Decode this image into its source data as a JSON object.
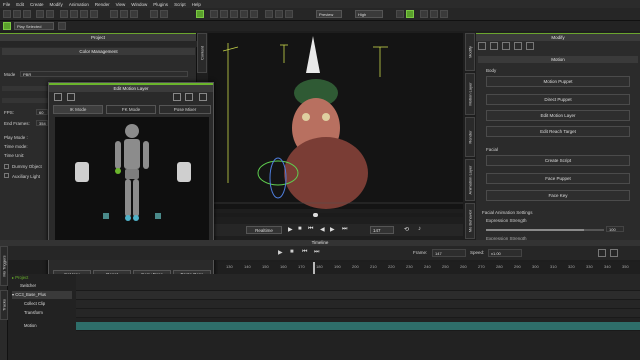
{
  "menu": [
    "File",
    "Edit",
    "Create",
    "Modify",
    "Animation",
    "Render",
    "View",
    "Window",
    "Plugins",
    "Script",
    "Help"
  ],
  "toolbar": {
    "render_quality": "Preview",
    "render_level": "High",
    "play_selected": "Play Selected"
  },
  "project_panel": {
    "title": "Project",
    "section": "Color Management",
    "mode_label": "Mode",
    "mode_value": "PBR",
    "fps_label": "FPS:",
    "fps_value": "60",
    "end_frame_label": "End Frames:",
    "end_frame_value": "354",
    "play_mode_label": "Play Mode :",
    "time_mode_label": "Time mode:",
    "time_unit_label": "Time Unit:",
    "dummy_object_label": "Dummy Object",
    "auxiliary_light_label": "Auxiliary Light"
  },
  "motion_layer": {
    "title": "Edit Motion Layer",
    "tabs": [
      "IK Mode",
      "FK Mode",
      "Pose Mixer"
    ],
    "ik_label": "IK",
    "fk_label": "FK",
    "buttons": [
      "Set Key",
      "Reset",
      "Copy Pose",
      "Paste Pose"
    ]
  },
  "viewport": {
    "playback_mode": "Realtime",
    "frame_value": "147"
  },
  "side_tabs": [
    "Content",
    "Modify",
    "Motion Layer",
    "Render",
    "Animation Layer",
    "Mo Behavior"
  ],
  "modify_panel": {
    "title": "Modify",
    "sub_title": "Motion",
    "body_section": "Body",
    "body_buttons": [
      "Motion Puppet",
      "Direct Puppet",
      "Edit Motion Layer",
      "Edit Reach Target"
    ],
    "facial_section": "Facial",
    "facial_buttons": [
      "Create Script",
      "Face Puppet",
      "Face Key"
    ],
    "facial_settings_label": "Facial Animation Settings",
    "expression_strength_label": "Expression Strength",
    "expression_strength_value": "100",
    "expression_strength_fraction": 0.83,
    "extra_label": "Expression Strength"
  },
  "timeline": {
    "title": "Timeline",
    "frame_label": "Frame:",
    "frame_value": "147",
    "speed_label": "Speed:",
    "speed_value": "x1.00",
    "ruler_marks": [
      "130",
      "140",
      "150",
      "160",
      "170",
      "180",
      "190",
      "200",
      "210",
      "220",
      "230",
      "240",
      "250",
      "260",
      "270",
      "280",
      "290",
      "300",
      "310",
      "320",
      "330",
      "340",
      "350"
    ],
    "rows": [
      {
        "label": "Project"
      },
      {
        "label": "Switcher"
      },
      {
        "label": "CC3_Base_Plus"
      },
      {
        "label": "Collect Clip"
      },
      {
        "label": "Transform"
      },
      {
        "label": "Motion"
      }
    ],
    "side_tab_top": "Mo Triggers",
    "side_tab_bottom": "Tracks"
  },
  "colors": {
    "accent": "#6bb52c",
    "panel": "#2b2b2b",
    "motion_track": "#2e6e6a"
  }
}
